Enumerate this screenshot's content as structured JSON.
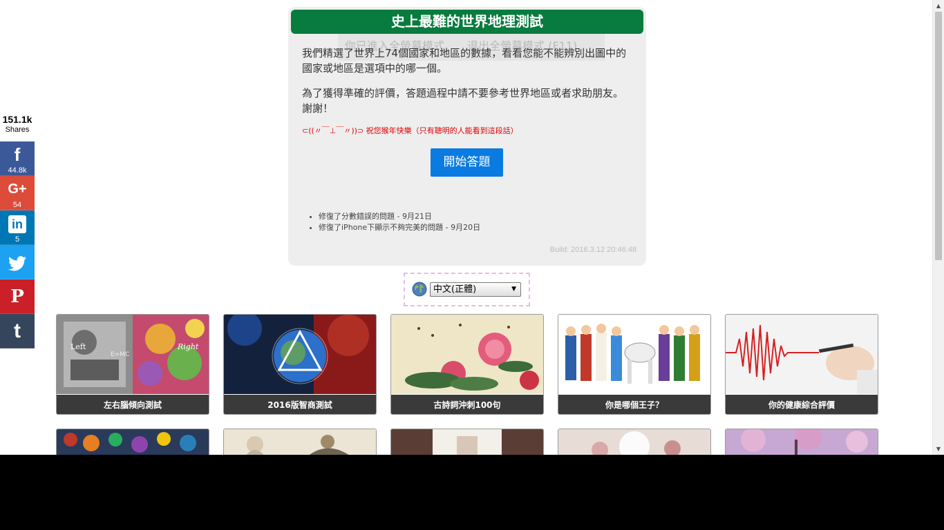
{
  "share": {
    "total": "151.1k",
    "total_label": "Shares",
    "buttons": [
      {
        "network": "facebook",
        "glyph": "f",
        "count": "44.8k",
        "color": "#3b5998",
        "icon": "facebook-icon"
      },
      {
        "network": "google-plus",
        "glyph": "G+",
        "count": "54",
        "color": "#dd4b39",
        "icon": "google-plus-icon"
      },
      {
        "network": "linkedin",
        "glyph": "in",
        "count": "5",
        "color": "#0077b5",
        "icon": "linkedin-icon"
      },
      {
        "network": "twitter",
        "glyph": "",
        "count": "",
        "color": "#1da1f2",
        "icon": "twitter-bird-icon"
      },
      {
        "network": "pinterest",
        "glyph": "P",
        "count": "",
        "color": "#cb2027",
        "icon": "pinterest-icon"
      },
      {
        "network": "tumblr",
        "glyph": "t",
        "count": "",
        "color": "#35465c",
        "icon": "tumblr-icon"
      }
    ]
  },
  "quiz": {
    "title": "史上最難的世界地理測試",
    "ghost_enter_fullscreen": "你已進入全螢幕模式",
    "ghost_exit_fullscreen": "退出全螢幕模式 (F11)",
    "intro": "我們精選了世界上74個國家和地區的數據，看看您能不能辨別出圖中的國家或地區是選項中的哪一個。",
    "advice": "為了獲得準確的評價，答題過程中請不要參考世界地區或者求助朋友。謝謝！",
    "note": "⊂((〃￣⊥￣〃))⊃ 祝您猴年快樂（只有聰明的人能看到這段話）",
    "start_label": "開始答題",
    "changelog": [
      "修復了分數錯誤的問題 - 9月21日",
      "修復了iPhone下顯示不夠完美的問題 - 9月20日"
    ],
    "build": "Build: 2016.3.12 20:46:48"
  },
  "language": {
    "selected": "中文(正體)",
    "icon": "globe-icon"
  },
  "tiles": [
    {
      "caption": "左右腦傾向測試",
      "art": "left-right-brain"
    },
    {
      "caption": "2016版智商測試",
      "art": "cosmic-triangle"
    },
    {
      "caption": "古詩詞沖刺100句",
      "art": "peony-painting"
    },
    {
      "caption": "你是哪個王子？",
      "art": "princes"
    },
    {
      "caption": "你的健康綜合評價",
      "art": "heartbeat-hand"
    }
  ],
  "tiles_row2": [
    {
      "art": "crowd"
    },
    {
      "art": "sages"
    },
    {
      "art": "person"
    },
    {
      "art": "blossom-white"
    },
    {
      "art": "cherry-pink"
    }
  ]
}
